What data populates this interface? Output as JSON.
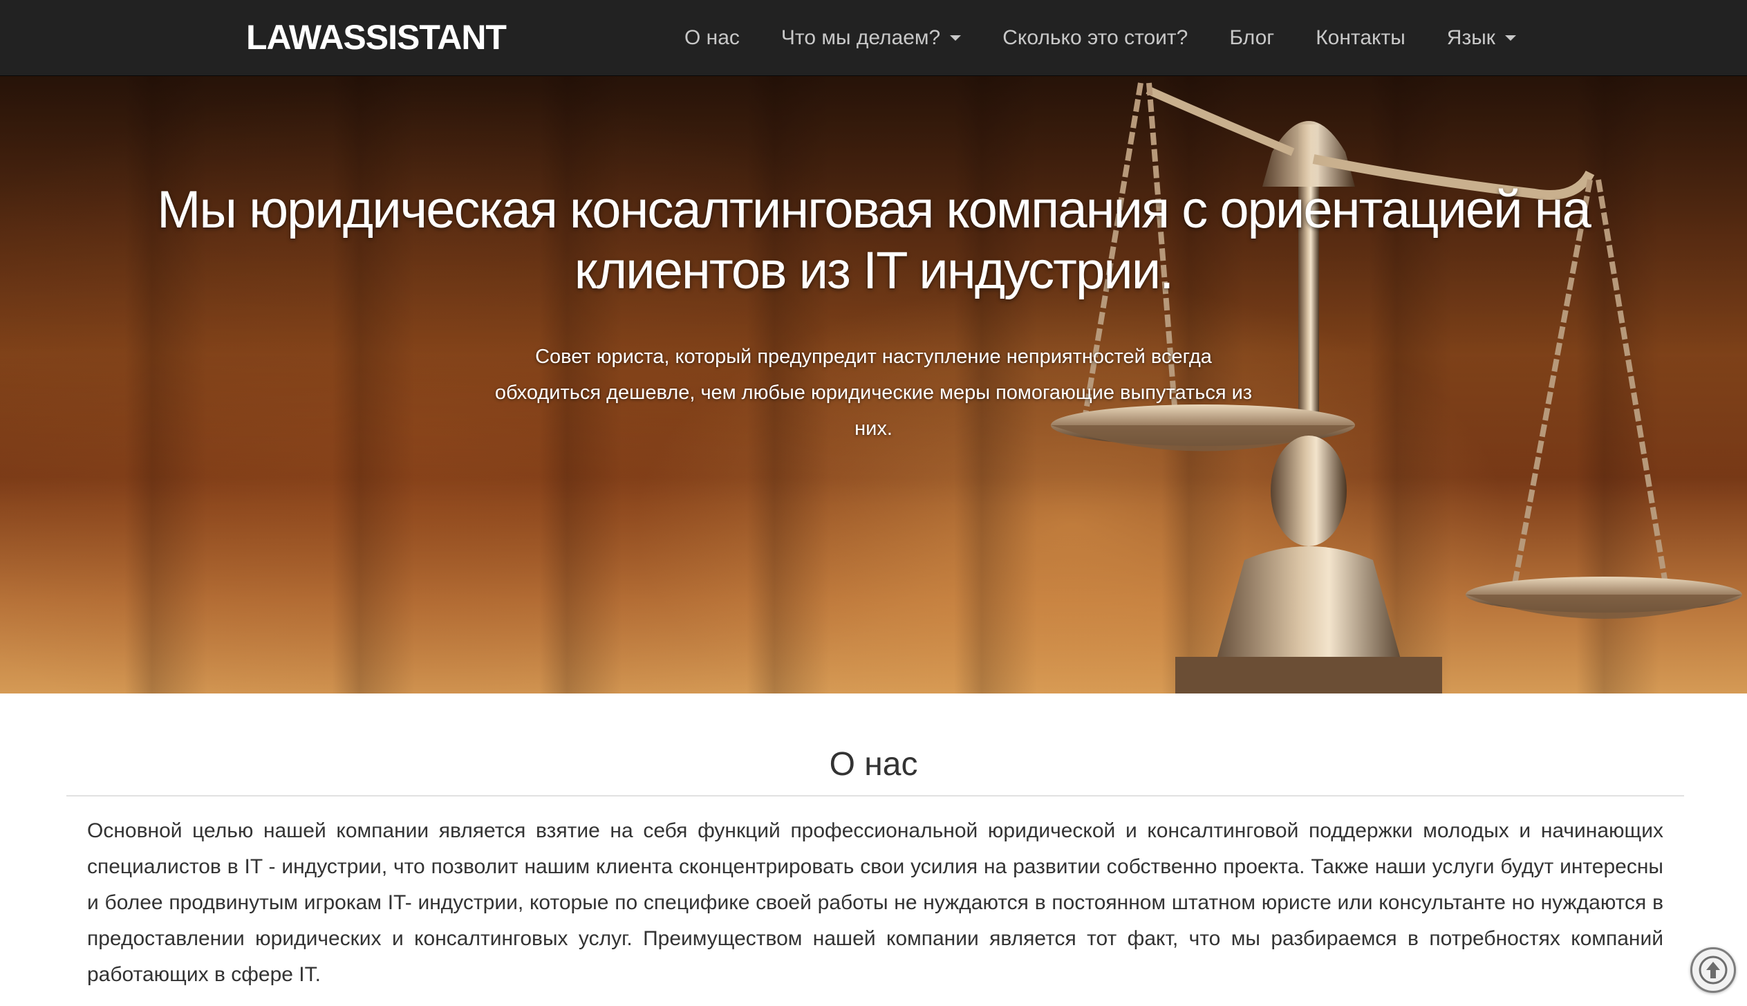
{
  "navbar": {
    "brand": "LAWASSISTANT",
    "items": [
      {
        "label": "О нас",
        "dropdown": false
      },
      {
        "label": "Что мы делаем?",
        "dropdown": true
      },
      {
        "label": "Сколько это стоит?",
        "dropdown": false
      },
      {
        "label": "Блог",
        "dropdown": false
      },
      {
        "label": "Контакты",
        "dropdown": false
      },
      {
        "label": "Язык",
        "dropdown": true
      }
    ]
  },
  "hero": {
    "title": "Мы юридическая консалтинговая компания с ориентацией на клиентов из IT индустрии.",
    "subtitle": "Совет юриста, который предупредит наступление неприятностей всегда обходиться дешевле, чем любые юридические меры помогающие выпутаться из них."
  },
  "about": {
    "heading": "О нас",
    "text": "Основной целью нашей компании является взятие на себя функций профессиональной юридической и консалтинговой поддержки молодых и начинающих специалистов в IT - индустрии, что позволит нашим клиента сконцентрировать свои усилия на развитии собственно проекта. Также наши услуги будут интересны и более продвинутым игрокам IT- индустрии, которые по специфике своей работы не нуждаются в постоянном штатном юристе или консультанте но нуждаются в предоставлении юридических и консалтинговых услуг. Преимуществом нашей компании является тот факт, что мы разбираемся в потребностях компаний работающих в сфере IT."
  },
  "icons": {
    "scroll_top": "arrow-up-circle-icon",
    "hero_image": "scales-of-justice"
  },
  "colors": {
    "navbar_bg": "#222222",
    "nav_text": "#c8c8c8",
    "brand_text": "#ffffff",
    "hero_text": "#ffffff",
    "body_text": "#333333"
  }
}
